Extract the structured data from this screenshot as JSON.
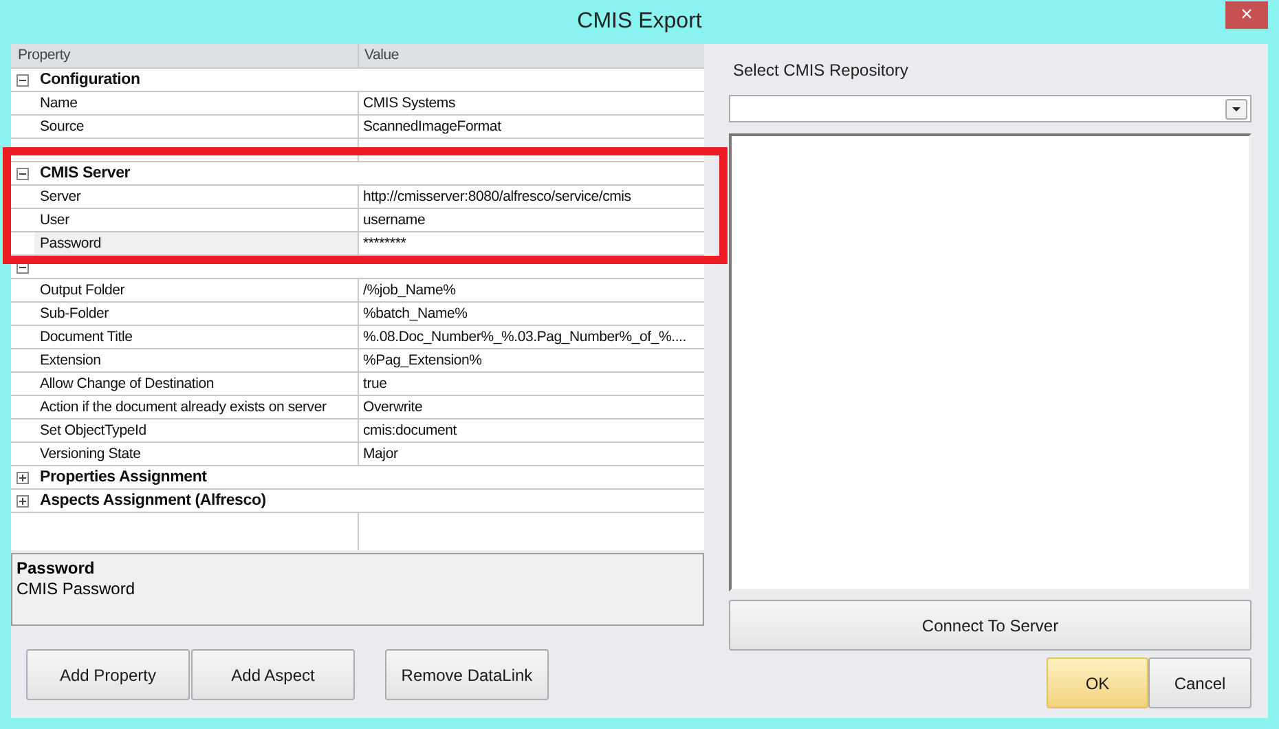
{
  "window": {
    "title": "CMIS Export",
    "close": "×"
  },
  "grid": {
    "columns": [
      "Property",
      "Value"
    ],
    "categories": [
      {
        "label": "Configuration",
        "expanded": true,
        "rows": [
          {
            "name": "Name",
            "value": "CMIS Systems",
            "selected": false
          },
          {
            "name": "Source",
            "value": "ScannedImageFormat",
            "selected": false
          },
          {
            "name": "",
            "value": "",
            "selected": false
          }
        ]
      },
      {
        "label": "CMIS Server",
        "expanded": true,
        "rows": [
          {
            "name": "Server",
            "value": "http://cmisserver:8080/alfresco/service/cmis",
            "selected": false
          },
          {
            "name": "User",
            "value": "username",
            "selected": false
          },
          {
            "name": "Password",
            "value": "********",
            "selected": true
          }
        ]
      },
      {
        "expanded": true,
        "rows": [
          {
            "name": "Output Folder",
            "value": "/%job_Name%",
            "selected": false
          },
          {
            "name": "Sub-Folder",
            "value": "%batch_Name%",
            "selected": false
          },
          {
            "name": "Document Title",
            "value": "%.08.Doc_Number%_%.03.Pag_Number%_of_%....",
            "selected": false
          },
          {
            "name": "Extension",
            "value": "%Pag_Extension%",
            "selected": false
          },
          {
            "name": "Allow Change of Destination",
            "value": "true",
            "selected": false
          },
          {
            "name": "Action if the document already exists on server",
            "value": "Overwrite",
            "selected": false
          },
          {
            "name": "Set ObjectTypeId",
            "value": "cmis:document",
            "selected": false
          },
          {
            "name": "Versioning State",
            "value": "Major",
            "selected": false
          }
        ]
      },
      {
        "label": "Properties Assignment",
        "expanded": false
      },
      {
        "label": "Aspects Assignment (Alfresco)",
        "expanded": false
      }
    ]
  },
  "description": {
    "title": "Password",
    "text": "CMIS Password"
  },
  "left_buttons": [
    "Add Property",
    "Add Aspect",
    "Remove DataLink"
  ],
  "repository": {
    "label": "Select CMIS Repository"
  },
  "connect_button": "Connect To Server",
  "dialog_buttons": [
    {
      "label": "OK",
      "default": true
    },
    {
      "label": "Cancel",
      "default": false
    }
  ]
}
